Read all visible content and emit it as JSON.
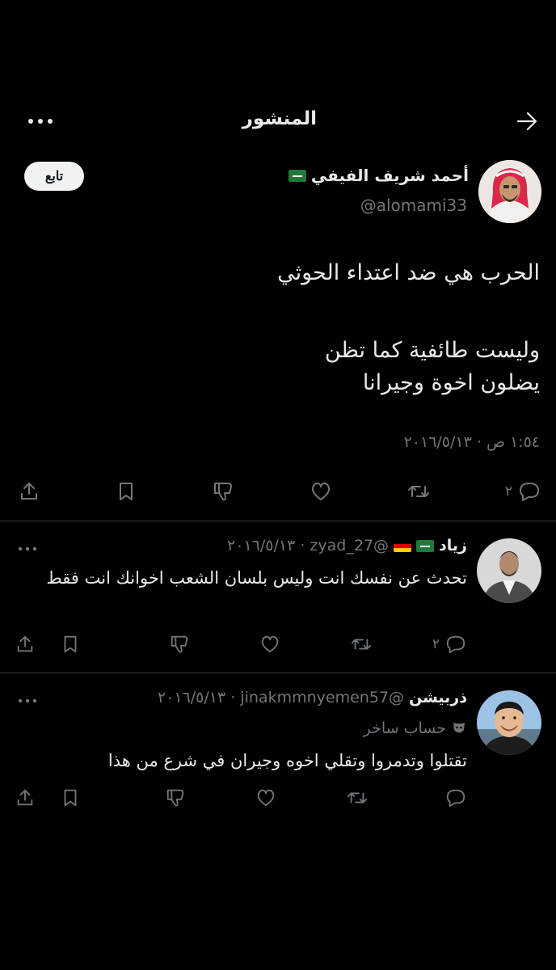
{
  "header": {
    "title": "المنشور"
  },
  "main_post": {
    "author_name": "أحمد شريف الفيفي",
    "handle": "@alomami33",
    "follow_label": "تابع",
    "lines": [
      "الحرب هي ضد اعتداء الحوثي",
      "",
      "وليست طائفية كما تظن",
      "يضلون اخوة وجيرانا"
    ],
    "timestamp": "١:٥٤ ص · ٢٠١٦/٥/١٣",
    "reply_count": "٢"
  },
  "replies": [
    {
      "name": "زياد",
      "handle_date": "@zyad_27 · ٢٠١٦/٥/١٣",
      "text": "تحدث عن نفسك انت وليس بلسان الشعب اخوانك انت فقط",
      "reply_count": "٢"
    },
    {
      "name": "ذربيشن",
      "handle_date": "@jinakmmnyemen57 · ٢٠١٦/٥/١٣",
      "label": "حساب ساخر",
      "text": "تقتلوا وتدمروا وتقلي اخوه وجيران في شرع من هذا",
      "reply_count": ""
    }
  ],
  "colors": {
    "background": "#000000",
    "text": "#e7e9ea",
    "muted": "#71767b",
    "divider": "#2f3336",
    "flag_green": "#1e7a3a"
  }
}
